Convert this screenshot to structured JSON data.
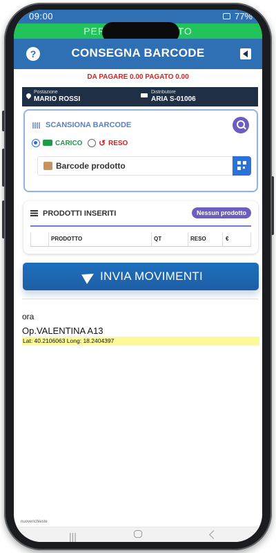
{
  "statusbar": {
    "time": "09:00",
    "battery": "77%"
  },
  "banner": {
    "text": "PERCORSO AVVIATO"
  },
  "header": {
    "help": "?",
    "title": "CONSEGNA BARCODE"
  },
  "summary": {
    "text": "DA PAGARE 0.00 PAGATO 0.00"
  },
  "info": {
    "postazione_label": "Postazione",
    "postazione_value": "MARIO ROSSI",
    "distributore_label": "Distributore",
    "distributore_value": "ARIA S-01006"
  },
  "scan": {
    "title": "SCANSIONA BARCODE",
    "options": [
      {
        "label": "CARICO",
        "selected": true,
        "color": "#1f9a4a"
      },
      {
        "label": "RESO",
        "selected": false,
        "color": "#d62222"
      }
    ],
    "input_placeholder": "Barcode prodotto"
  },
  "products": {
    "title": "PRODOTTI INSERITI",
    "badge": "Nessun prodotto",
    "columns": [
      "PRODOTTO",
      "QT",
      "RESO",
      "€"
    ]
  },
  "send": {
    "label": "INVIA MOVIMENTI"
  },
  "log": {
    "time": "ora",
    "operator": "Op.VALENTINA A13",
    "coords": "Lat: 40.2106063 Long: 18.2404397"
  },
  "footer": {
    "note": "nuoverichieste"
  },
  "colors": {
    "primary": "#2f6fb4",
    "dark": "#1f2f45",
    "accent": "#6a5fbf",
    "success": "#22c35a",
    "danger": "#d62222"
  }
}
